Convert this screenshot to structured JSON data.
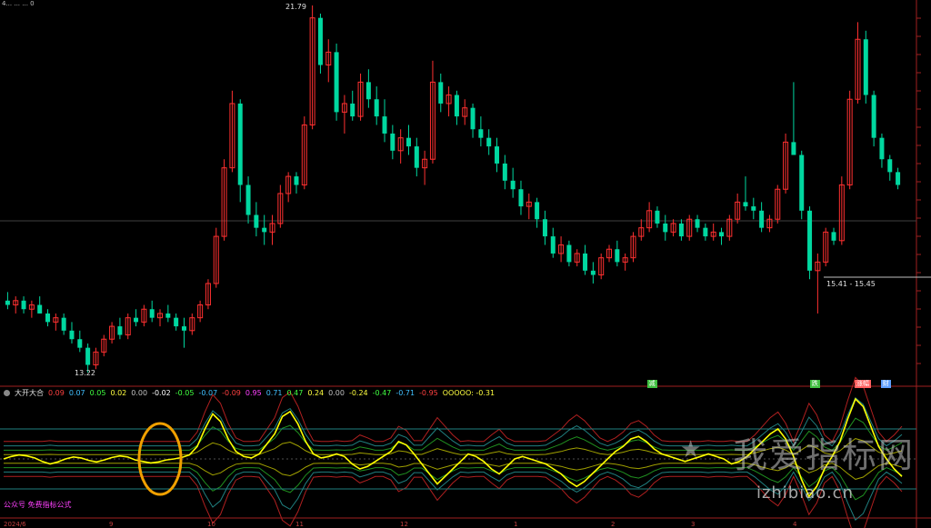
{
  "chart_data": {
    "type": "candlestick",
    "annotations": {
      "high_label": "21.79",
      "low_label": "13.22",
      "range_label": "15.41 - 15.45"
    },
    "candles": [
      {
        "o": 14.9,
        "h": 15.1,
        "l": 14.7,
        "c": 14.8
      },
      {
        "o": 14.8,
        "h": 15.0,
        "l": 14.6,
        "c": 14.9
      },
      {
        "o": 14.9,
        "h": 15.0,
        "l": 14.6,
        "c": 14.7
      },
      {
        "o": 14.7,
        "h": 14.9,
        "l": 14.5,
        "c": 14.8
      },
      {
        "o": 14.8,
        "h": 15.0,
        "l": 14.6,
        "c": 14.6
      },
      {
        "o": 14.6,
        "h": 14.7,
        "l": 14.3,
        "c": 14.4
      },
      {
        "o": 14.4,
        "h": 14.6,
        "l": 14.2,
        "c": 14.5
      },
      {
        "o": 14.5,
        "h": 14.6,
        "l": 14.1,
        "c": 14.2
      },
      {
        "o": 14.2,
        "h": 14.4,
        "l": 13.9,
        "c": 14.0
      },
      {
        "o": 14.0,
        "h": 14.2,
        "l": 13.7,
        "c": 13.8
      },
      {
        "o": 13.8,
        "h": 13.9,
        "l": 13.22,
        "c": 13.4
      },
      {
        "o": 13.4,
        "h": 13.8,
        "l": 13.3,
        "c": 13.7
      },
      {
        "o": 13.7,
        "h": 14.1,
        "l": 13.6,
        "c": 14.0
      },
      {
        "o": 14.0,
        "h": 14.4,
        "l": 13.9,
        "c": 14.3
      },
      {
        "o": 14.3,
        "h": 14.5,
        "l": 14.0,
        "c": 14.1
      },
      {
        "o": 14.1,
        "h": 14.6,
        "l": 14.0,
        "c": 14.5
      },
      {
        "o": 14.5,
        "h": 14.7,
        "l": 14.3,
        "c": 14.4
      },
      {
        "o": 14.4,
        "h": 14.8,
        "l": 14.3,
        "c": 14.7
      },
      {
        "o": 14.7,
        "h": 14.9,
        "l": 14.4,
        "c": 14.5
      },
      {
        "o": 14.5,
        "h": 14.7,
        "l": 14.3,
        "c": 14.6
      },
      {
        "o": 14.6,
        "h": 14.8,
        "l": 14.4,
        "c": 14.5
      },
      {
        "o": 14.5,
        "h": 14.6,
        "l": 14.2,
        "c": 14.3
      },
      {
        "o": 14.3,
        "h": 14.5,
        "l": 13.8,
        "c": 14.2
      },
      {
        "o": 14.2,
        "h": 14.6,
        "l": 14.1,
        "c": 14.5
      },
      {
        "o": 14.5,
        "h": 14.9,
        "l": 14.4,
        "c": 14.8
      },
      {
        "o": 14.8,
        "h": 15.4,
        "l": 14.7,
        "c": 15.3
      },
      {
        "o": 15.3,
        "h": 16.6,
        "l": 15.2,
        "c": 16.4
      },
      {
        "o": 16.4,
        "h": 18.2,
        "l": 16.3,
        "c": 18.0
      },
      {
        "o": 18.0,
        "h": 19.8,
        "l": 17.9,
        "c": 19.5
      },
      {
        "o": 19.5,
        "h": 19.6,
        "l": 17.2,
        "c": 17.6
      },
      {
        "o": 17.6,
        "h": 17.8,
        "l": 16.7,
        "c": 16.9
      },
      {
        "o": 16.9,
        "h": 17.2,
        "l": 16.4,
        "c": 16.6
      },
      {
        "o": 16.6,
        "h": 16.9,
        "l": 16.2,
        "c": 16.5
      },
      {
        "o": 16.5,
        "h": 16.9,
        "l": 16.2,
        "c": 16.7
      },
      {
        "o": 16.7,
        "h": 17.6,
        "l": 16.6,
        "c": 17.4
      },
      {
        "o": 17.4,
        "h": 17.9,
        "l": 17.2,
        "c": 17.8
      },
      {
        "o": 17.8,
        "h": 17.9,
        "l": 17.4,
        "c": 17.6
      },
      {
        "o": 17.6,
        "h": 19.2,
        "l": 17.5,
        "c": 19.0
      },
      {
        "o": 19.0,
        "h": 21.79,
        "l": 18.9,
        "c": 21.5
      },
      {
        "o": 21.5,
        "h": 21.6,
        "l": 20.2,
        "c": 20.4
      },
      {
        "o": 20.4,
        "h": 21.0,
        "l": 20.0,
        "c": 20.7
      },
      {
        "o": 20.7,
        "h": 20.9,
        "l": 19.1,
        "c": 19.3
      },
      {
        "o": 19.3,
        "h": 19.7,
        "l": 18.8,
        "c": 19.5
      },
      {
        "o": 19.5,
        "h": 19.8,
        "l": 19.1,
        "c": 19.2
      },
      {
        "o": 19.2,
        "h": 20.2,
        "l": 19.1,
        "c": 20.0
      },
      {
        "o": 20.0,
        "h": 20.3,
        "l": 19.4,
        "c": 19.6
      },
      {
        "o": 19.6,
        "h": 19.9,
        "l": 19.0,
        "c": 19.2
      },
      {
        "o": 19.2,
        "h": 19.6,
        "l": 18.6,
        "c": 18.8
      },
      {
        "o": 18.8,
        "h": 19.0,
        "l": 18.2,
        "c": 18.4
      },
      {
        "o": 18.4,
        "h": 18.9,
        "l": 18.1,
        "c": 18.7
      },
      {
        "o": 18.7,
        "h": 19.0,
        "l": 18.3,
        "c": 18.5
      },
      {
        "o": 18.5,
        "h": 18.7,
        "l": 17.8,
        "c": 18.0
      },
      {
        "o": 18.0,
        "h": 18.4,
        "l": 17.6,
        "c": 18.2
      },
      {
        "o": 18.2,
        "h": 20.5,
        "l": 18.1,
        "c": 20.0
      },
      {
        "o": 20.0,
        "h": 20.2,
        "l": 19.3,
        "c": 19.5
      },
      {
        "o": 19.5,
        "h": 19.9,
        "l": 19.2,
        "c": 19.7
      },
      {
        "o": 19.7,
        "h": 19.8,
        "l": 19.0,
        "c": 19.2
      },
      {
        "o": 19.2,
        "h": 19.6,
        "l": 19.0,
        "c": 19.4
      },
      {
        "o": 19.4,
        "h": 19.5,
        "l": 18.7,
        "c": 18.9
      },
      {
        "o": 18.9,
        "h": 19.2,
        "l": 18.5,
        "c": 18.7
      },
      {
        "o": 18.7,
        "h": 18.9,
        "l": 18.3,
        "c": 18.5
      },
      {
        "o": 18.5,
        "h": 18.7,
        "l": 17.9,
        "c": 18.1
      },
      {
        "o": 18.1,
        "h": 18.3,
        "l": 17.5,
        "c": 17.7
      },
      {
        "o": 17.7,
        "h": 18.0,
        "l": 17.3,
        "c": 17.5
      },
      {
        "o": 17.5,
        "h": 17.7,
        "l": 16.9,
        "c": 17.1
      },
      {
        "o": 17.1,
        "h": 17.4,
        "l": 16.8,
        "c": 17.2
      },
      {
        "o": 17.2,
        "h": 17.3,
        "l": 16.6,
        "c": 16.8
      },
      {
        "o": 16.8,
        "h": 17.0,
        "l": 16.2,
        "c": 16.4
      },
      {
        "o": 16.4,
        "h": 16.6,
        "l": 15.9,
        "c": 16.0
      },
      {
        "o": 16.0,
        "h": 16.4,
        "l": 15.8,
        "c": 16.2
      },
      {
        "o": 16.2,
        "h": 16.3,
        "l": 15.7,
        "c": 15.8
      },
      {
        "o": 15.8,
        "h": 16.1,
        "l": 15.7,
        "c": 16.0
      },
      {
        "o": 16.0,
        "h": 16.2,
        "l": 15.5,
        "c": 15.6
      },
      {
        "o": 15.6,
        "h": 15.8,
        "l": 15.3,
        "c": 15.5
      },
      {
        "o": 15.5,
        "h": 16.0,
        "l": 15.4,
        "c": 15.9
      },
      {
        "o": 15.9,
        "h": 16.2,
        "l": 15.8,
        "c": 16.1
      },
      {
        "o": 16.1,
        "h": 16.3,
        "l": 15.7,
        "c": 15.8
      },
      {
        "o": 15.8,
        "h": 16.0,
        "l": 15.6,
        "c": 15.9
      },
      {
        "o": 15.9,
        "h": 16.5,
        "l": 15.8,
        "c": 16.4
      },
      {
        "o": 16.4,
        "h": 16.8,
        "l": 16.3,
        "c": 16.6
      },
      {
        "o": 16.6,
        "h": 17.2,
        "l": 16.5,
        "c": 17.0
      },
      {
        "o": 17.0,
        "h": 17.1,
        "l": 16.6,
        "c": 16.7
      },
      {
        "o": 16.7,
        "h": 16.9,
        "l": 16.3,
        "c": 16.5
      },
      {
        "o": 16.5,
        "h": 16.8,
        "l": 16.4,
        "c": 16.7
      },
      {
        "o": 16.7,
        "h": 16.8,
        "l": 16.3,
        "c": 16.4
      },
      {
        "o": 16.4,
        "h": 16.9,
        "l": 16.3,
        "c": 16.8
      },
      {
        "o": 16.8,
        "h": 16.9,
        "l": 16.5,
        "c": 16.6
      },
      {
        "o": 16.6,
        "h": 16.7,
        "l": 16.3,
        "c": 16.4
      },
      {
        "o": 16.4,
        "h": 16.7,
        "l": 16.3,
        "c": 16.5
      },
      {
        "o": 16.5,
        "h": 16.6,
        "l": 16.2,
        "c": 16.4
      },
      {
        "o": 16.4,
        "h": 16.9,
        "l": 16.3,
        "c": 16.8
      },
      {
        "o": 16.8,
        "h": 17.4,
        "l": 16.7,
        "c": 17.2
      },
      {
        "o": 17.2,
        "h": 17.8,
        "l": 17.0,
        "c": 17.1
      },
      {
        "o": 17.1,
        "h": 17.3,
        "l": 16.8,
        "c": 17.0
      },
      {
        "o": 17.0,
        "h": 17.2,
        "l": 16.5,
        "c": 16.6
      },
      {
        "o": 16.6,
        "h": 16.9,
        "l": 16.5,
        "c": 16.8
      },
      {
        "o": 16.8,
        "h": 17.6,
        "l": 16.7,
        "c": 17.5
      },
      {
        "o": 17.5,
        "h": 18.8,
        "l": 17.4,
        "c": 18.6
      },
      {
        "o": 18.6,
        "h": 20.0,
        "l": 18.5,
        "c": 18.3
      },
      {
        "o": 18.3,
        "h": 18.4,
        "l": 16.8,
        "c": 17.0
      },
      {
        "o": 17.0,
        "h": 17.1,
        "l": 15.4,
        "c": 15.6
      },
      {
        "o": 15.6,
        "h": 16.0,
        "l": 14.6,
        "c": 15.8
      },
      {
        "o": 15.8,
        "h": 16.6,
        "l": 15.7,
        "c": 16.5
      },
      {
        "o": 16.5,
        "h": 16.6,
        "l": 16.2,
        "c": 16.3
      },
      {
        "o": 16.3,
        "h": 17.8,
        "l": 16.2,
        "c": 17.6
      },
      {
        "o": 17.6,
        "h": 19.8,
        "l": 17.5,
        "c": 19.6
      },
      {
        "o": 19.6,
        "h": 21.4,
        "l": 19.5,
        "c": 21.0
      },
      {
        "o": 21.0,
        "h": 21.2,
        "l": 19.5,
        "c": 19.7
      },
      {
        "o": 19.7,
        "h": 19.8,
        "l": 18.5,
        "c": 18.7
      },
      {
        "o": 18.7,
        "h": 18.8,
        "l": 18.0,
        "c": 18.2
      },
      {
        "o": 18.2,
        "h": 18.3,
        "l": 17.7,
        "c": 17.9
      },
      {
        "o": 17.9,
        "h": 18.0,
        "l": 17.5,
        "c": 17.6
      }
    ],
    "indicator": {
      "title": "大开大合",
      "values": [
        {
          "text": "0.09",
          "color": "#ff4040"
        },
        {
          "text": "0.07",
          "color": "#40c0ff"
        },
        {
          "text": "0.05",
          "color": "#40ff40"
        },
        {
          "text": "0.02",
          "color": "#ffff40"
        },
        {
          "text": "0.00",
          "color": "#c0c0c0"
        },
        {
          "text": "-0.02",
          "color": "#ffffff"
        },
        {
          "text": "-0.05",
          "color": "#40ff40"
        },
        {
          "text": "-0.07",
          "color": "#40c0ff"
        },
        {
          "text": "-0.09",
          "color": "#ff4040"
        },
        {
          "text": "0.95",
          "color": "#ff40ff"
        },
        {
          "text": "0.71",
          "color": "#40c0ff"
        },
        {
          "text": "0.47",
          "color": "#40ff40"
        },
        {
          "text": "0.24",
          "color": "#ffff40"
        },
        {
          "text": "0.00",
          "color": "#c0c0c0"
        },
        {
          "text": "-0.24",
          "color": "#ffff40"
        },
        {
          "text": "-0.47",
          "color": "#40ff40"
        },
        {
          "text": "-0.71",
          "color": "#40c0ff"
        },
        {
          "text": "-0.95",
          "color": "#ff4040"
        },
        {
          "text": "OOOOO: -0.31",
          "color": "#ffff40"
        }
      ],
      "oscillator": [
        0.0,
        0.05,
        0.08,
        0.06,
        0.02,
        -0.05,
        -0.1,
        -0.06,
        0.0,
        0.04,
        0.02,
        -0.03,
        -0.06,
        -0.02,
        0.03,
        0.06,
        0.04,
        -0.02,
        -0.05,
        -0.08,
        -0.06,
        -0.02,
        0.0,
        0.03,
        0.08,
        0.25,
        0.6,
        0.9,
        0.75,
        0.4,
        0.15,
        0.05,
        0.02,
        0.1,
        0.3,
        0.5,
        0.85,
        0.95,
        0.7,
        0.35,
        0.1,
        0.02,
        0.05,
        0.1,
        0.05,
        -0.1,
        -0.2,
        -0.15,
        -0.05,
        0.05,
        0.15,
        0.35,
        0.28,
        0.1,
        -0.1,
        -0.3,
        -0.5,
        -0.35,
        -0.2,
        -0.05,
        0.1,
        0.05,
        -0.05,
        -0.2,
        -0.3,
        -0.15,
        0.0,
        0.05,
        0.0,
        -0.05,
        -0.1,
        -0.2,
        -0.3,
        -0.45,
        -0.55,
        -0.45,
        -0.3,
        -0.15,
        0.0,
        0.15,
        0.25,
        0.4,
        0.45,
        0.35,
        0.2,
        0.1,
        0.05,
        0.0,
        -0.05,
        0.0,
        0.05,
        0.1,
        0.05,
        0.0,
        -0.1,
        -0.05,
        0.05,
        0.2,
        0.35,
        0.5,
        0.6,
        0.4,
        0.05,
        -0.4,
        -0.75,
        -0.55,
        -0.2,
        0.05,
        0.35,
        0.8,
        1.2,
        1.05,
        0.65,
        0.25,
        0.0,
        -0.2,
        -0.35
      ],
      "marker_label": "公众号 免费指标公式"
    },
    "badges": [
      {
        "text": "减",
        "color": "#40c040",
        "pos": 0.695
      },
      {
        "text": "跌",
        "color": "#40c040",
        "pos": 0.87
      },
      {
        "text": "涨幅",
        "color": "#ff6060",
        "pos": 0.918
      },
      {
        "text": "财",
        "color": "#60a0ff",
        "pos": 0.946
      }
    ],
    "xaxis": [
      "2024/6",
      "9",
      "10",
      "11",
      "12",
      "1",
      "2",
      "3",
      "4"
    ],
    "top_title": "4... ... ... 0"
  },
  "watermark": {
    "main": "我爱指标网",
    "sub": "izhibiao.cn",
    "star": "★"
  },
  "colors": {
    "up": "#ff3030",
    "down": "#00d8a0",
    "osc_line": "#ffff00",
    "highlight_circle": "#f0a000"
  }
}
